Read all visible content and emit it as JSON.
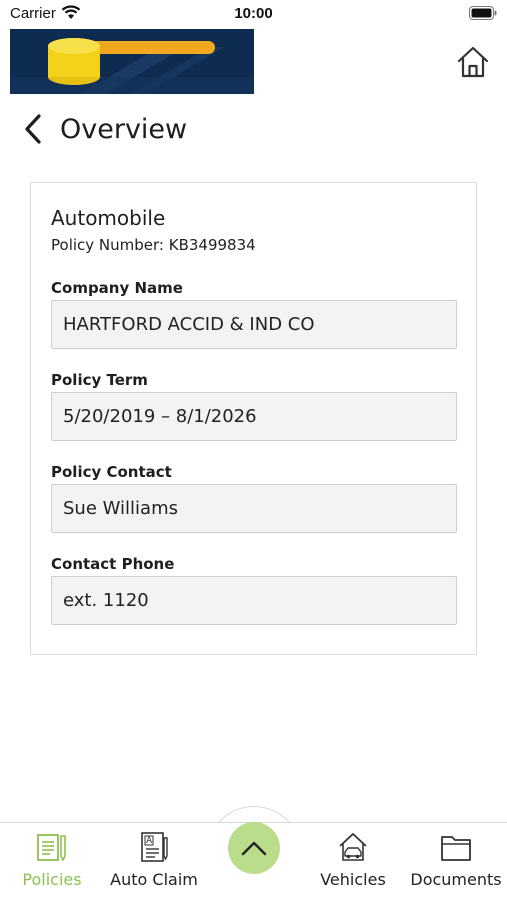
{
  "status_bar": {
    "carrier": "Carrier",
    "time": "10:00"
  },
  "header": {
    "title": "Overview"
  },
  "policy": {
    "type": "Automobile",
    "number": "Policy Number: KB3499834",
    "fields": [
      {
        "label": "Company Name",
        "value": "HARTFORD ACCID & IND CO"
      },
      {
        "label": "Policy Term",
        "value": "5/20/2019 – 8/1/2026"
      },
      {
        "label": "Policy Contact",
        "value": "Sue Williams"
      },
      {
        "label": "Contact Phone",
        "value": "ext. 1120"
      }
    ]
  },
  "bottom_nav": {
    "items": [
      {
        "label": "Policies",
        "icon": "policies-icon",
        "active": true
      },
      {
        "label": "Auto Claim",
        "icon": "auto-claim-icon",
        "active": false
      },
      {
        "label": "Vehicles",
        "icon": "vehicles-icon",
        "active": false
      },
      {
        "label": "Documents",
        "icon": "documents-icon",
        "active": false
      }
    ],
    "fab_icon": "chevron-up-icon"
  },
  "colors": {
    "accent": "#8dc04f",
    "fab": "#b9dd8a",
    "banner": "#0e2c52",
    "brand_yellow": "#f2d21b",
    "brand_orange": "#f0a81e"
  }
}
